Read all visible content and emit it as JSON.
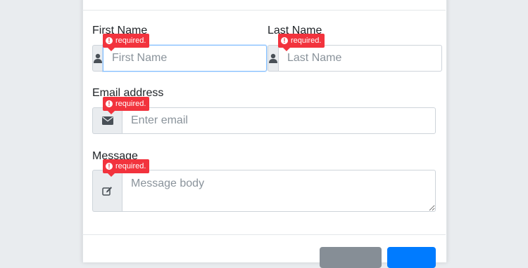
{
  "form": {
    "first_name": {
      "label": "First Name",
      "placeholder": "First Name",
      "error": "required.",
      "icon": "user-icon"
    },
    "last_name": {
      "label": "Last Name",
      "placeholder": "Last Name",
      "error": "required.",
      "icon": "user-icon"
    },
    "email": {
      "label": "Email address",
      "placeholder": "Enter email",
      "error": "required.",
      "icon": "envelope-icon"
    },
    "message": {
      "label": "Message",
      "placeholder": "Message body",
      "error": "required.",
      "icon": "edit-icon"
    }
  },
  "colors": {
    "error": "#f2333d",
    "primary": "#007bff",
    "secondary": "#868e96",
    "focus_border": "#80bdff"
  }
}
